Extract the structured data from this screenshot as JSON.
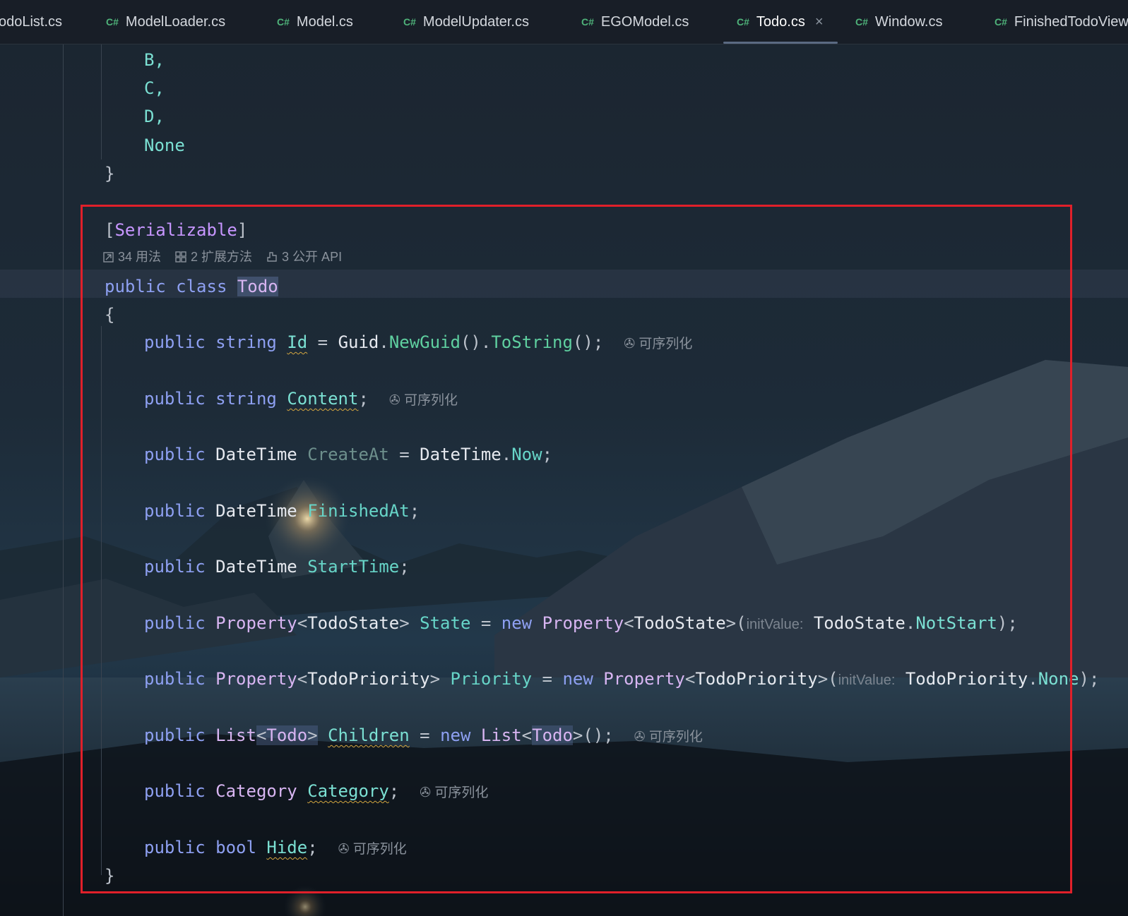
{
  "tabs": [
    {
      "label": "odoList.cs",
      "icon": "csharp-file-icon",
      "active": false
    },
    {
      "label": "ModelLoader.cs",
      "icon": "csharp-file-icon",
      "active": false
    },
    {
      "label": "Model.cs",
      "icon": "csharp-file-icon",
      "active": false
    },
    {
      "label": "ModelUpdater.cs",
      "icon": "csharp-file-icon",
      "active": false
    },
    {
      "label": "EGOModel.cs",
      "icon": "csharp-file-icon",
      "active": false
    },
    {
      "label": "Todo.cs",
      "icon": "csharp-file-icon",
      "active": true
    },
    {
      "label": "Window.cs",
      "icon": "csharp-file-icon",
      "active": false
    },
    {
      "label": "FinishedTodoView",
      "icon": "csharp-file-icon",
      "active": false
    }
  ],
  "tab_icon_text": "C#",
  "close_glyph": "×",
  "codelens": {
    "usages": "34 用法",
    "extension_methods": "2 扩展方法",
    "public_api": "3 公开 API"
  },
  "serializable_hint": "可序列化",
  "init_value_hint": "initValue:",
  "enum_tail": [
    "B,",
    "C,",
    "D,",
    "None"
  ],
  "code": {
    "attribute": "Serializable",
    "kw_public": "public",
    "kw_class": "class",
    "kw_new": "new",
    "kw_string": "string",
    "kw_bool": "bool",
    "class_name": "Todo",
    "id_field": "Id",
    "guid": "Guid",
    "new_guid": "NewGuid",
    "to_string": "ToString",
    "content_field": "Content",
    "datetime": "DateTime",
    "createat_field": "CreateAt",
    "now": "Now",
    "finishedat_field": "FinishedAt",
    "starttime_field": "StartTime",
    "property_type": "Property",
    "todostate": "TodoState",
    "state_field": "State",
    "notstart": "NotStart",
    "todopriority": "TodoPriority",
    "priority_field": "Priority",
    "none": "None",
    "list_type": "List",
    "children_field": "Children",
    "category_type": "Category",
    "category_field": "Category",
    "hide_field": "Hide"
  },
  "colors": {
    "highlight_box": "#e0202a",
    "keyword": "#8ea0f2",
    "field": "#67d5c8",
    "type": "#d8b5f2"
  }
}
